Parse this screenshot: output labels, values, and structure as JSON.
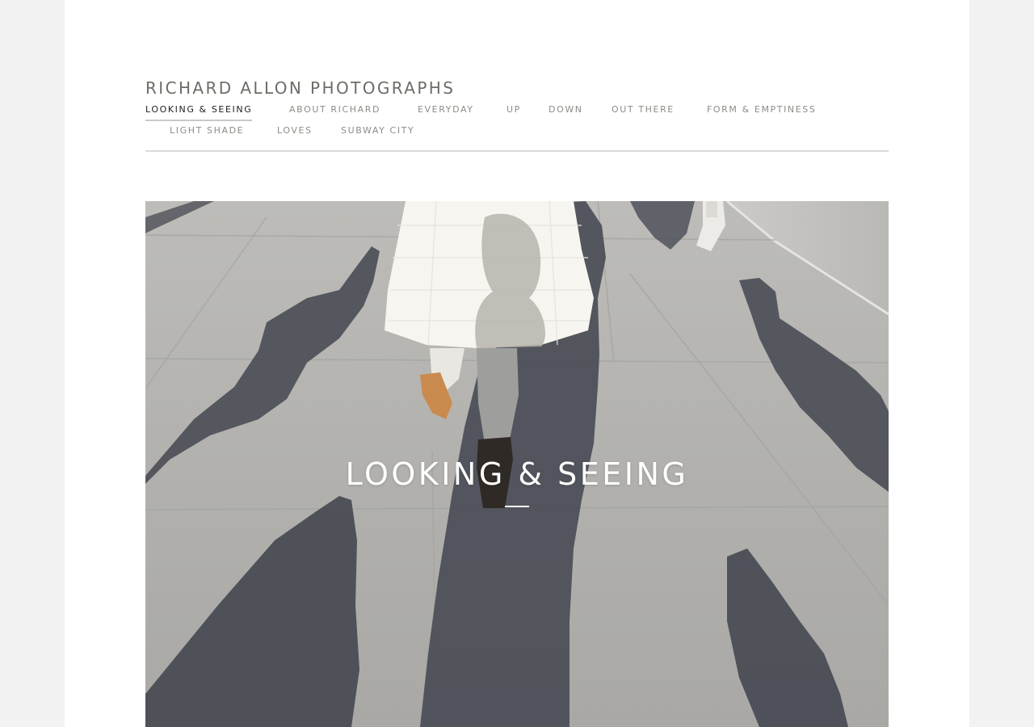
{
  "site": {
    "title": "RICHARD ALLON PHOTOGRAPHS"
  },
  "nav": {
    "items": [
      {
        "label": "LOOKING & SEEING",
        "active": true
      },
      {
        "label": "ABOUT RICHARD",
        "active": false
      },
      {
        "label": "EVERYDAY",
        "active": false
      },
      {
        "label": "UP",
        "active": false
      },
      {
        "label": "DOWN",
        "active": false
      },
      {
        "label": "OUT THERE",
        "active": false
      },
      {
        "label": "FORM & EMPTINESS",
        "active": false
      },
      {
        "label": "LIGHT SHADE",
        "active": false
      },
      {
        "label": "LOVES",
        "active": false
      },
      {
        "label": "SUBWAY CITY",
        "active": false
      }
    ]
  },
  "hero": {
    "caption": "LOOKING & SEEING"
  },
  "colors": {
    "page_background": "#f2f2f2",
    "content_background": "#ffffff",
    "title_text": "#6f6c67",
    "nav_text": "#8f8c87",
    "nav_active_text": "#1f1f1f",
    "divider": "#dadada"
  }
}
